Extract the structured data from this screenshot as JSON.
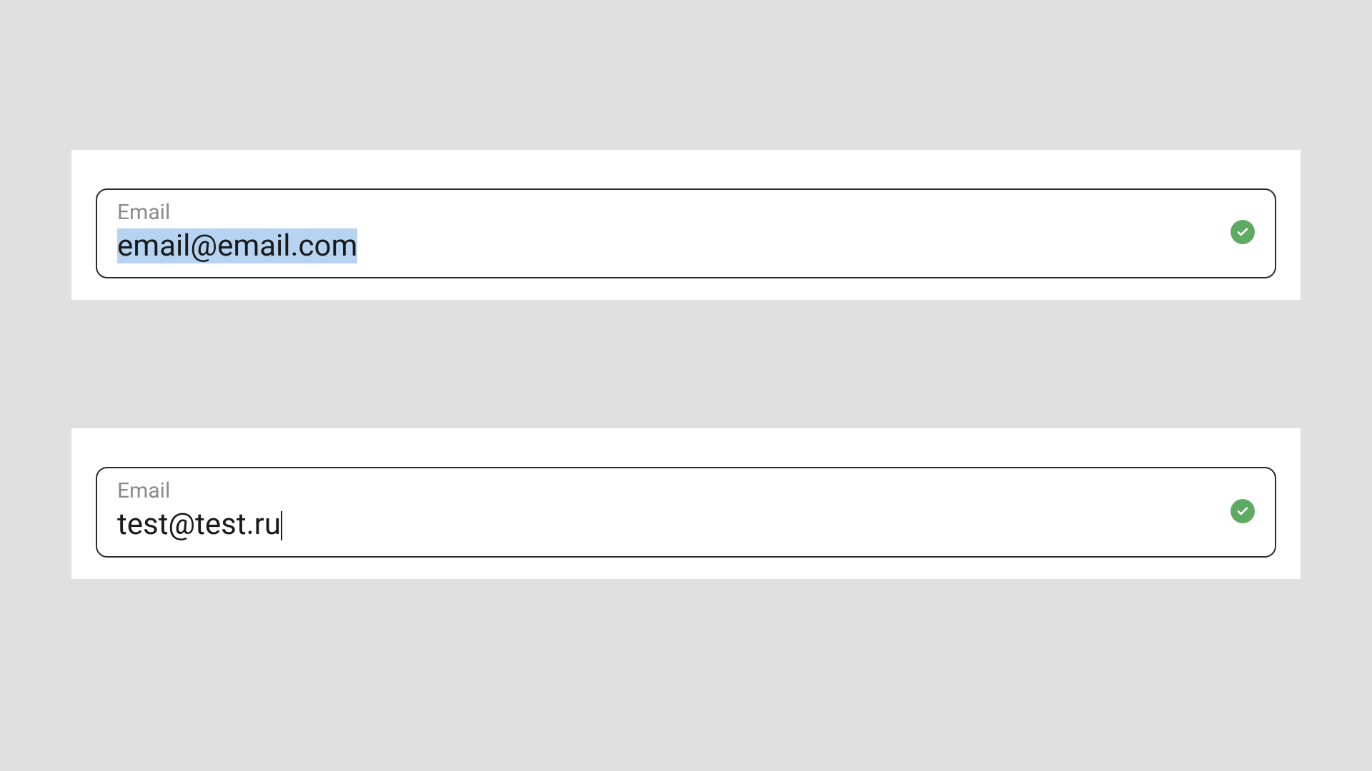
{
  "fields": [
    {
      "label": "Email",
      "value": "email@email.com",
      "selected": true,
      "valid": true
    },
    {
      "label": "Email",
      "value": "test@test.ru",
      "selected": false,
      "valid": true
    }
  ],
  "colors": {
    "success": "#5faa63",
    "border": "#2a2a2a",
    "labelMuted": "#8a8a8a",
    "selectionBg": "#b7d3f2"
  }
}
